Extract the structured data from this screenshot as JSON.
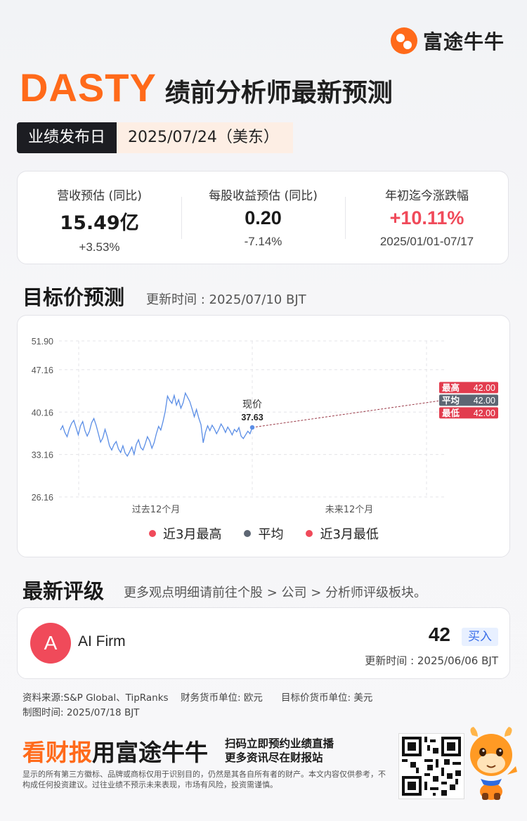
{
  "brand": {
    "logo_text": "富途牛牛"
  },
  "header": {
    "ticker": "DASTY",
    "title": "绩前分析师最新预测",
    "date_label": "业绩发布日",
    "date_value": "2025/07/24（美东）"
  },
  "stats": [
    {
      "label": "营收预估 (同比)",
      "value": "15.49亿",
      "sub": "+3.53%"
    },
    {
      "label": "每股收益预估 (同比)",
      "value": "0.20",
      "sub": "-7.14%"
    },
    {
      "label": "年初迄今涨跌幅",
      "value": "+10.11%",
      "sub": "2025/01/01-07/17"
    }
  ],
  "target_section": {
    "title": "目标价预测",
    "updated": "更新时间 : 2025/07/10 BJT"
  },
  "chart_data": {
    "type": "line",
    "y_ticks": [
      "51.90",
      "47.16",
      "40.16",
      "33.16",
      "26.16"
    ],
    "ylim": [
      26.16,
      51.9
    ],
    "x_labels": [
      "过去12个月",
      "未来12个月"
    ],
    "current_label": "现价",
    "current_price": "37.63",
    "history": [
      37.2,
      37.9,
      36.8,
      36.1,
      37.4,
      38.3,
      38.8,
      37.6,
      36.4,
      37.9,
      38.6,
      37.1,
      36.2,
      37.0,
      38.4,
      39.1,
      38.0,
      36.6,
      35.2,
      35.9,
      37.3,
      36.1,
      34.6,
      33.9,
      34.8,
      35.3,
      34.1,
      33.5,
      34.6,
      33.4,
      32.9,
      33.6,
      34.4,
      33.2,
      34.8,
      35.6,
      34.3,
      33.9,
      34.9,
      36.1,
      35.4,
      34.2,
      35.1,
      36.6,
      37.8,
      37.2,
      38.6,
      40.3,
      42.8,
      42.1,
      41.6,
      42.9,
      41.3,
      42.2,
      40.8,
      41.7,
      43.3,
      42.6,
      41.9,
      40.7,
      39.4,
      40.6,
      39.2,
      38.1,
      35.1,
      36.8,
      37.9,
      37.1,
      38.0,
      37.4,
      36.6,
      37.3,
      38.2,
      37.6,
      36.8,
      37.7,
      37.1,
      36.4,
      37.3,
      36.9,
      37.6,
      36.2,
      35.8,
      36.4,
      37.0,
      36.6,
      37.63
    ],
    "targets": [
      {
        "label": "最高",
        "value": "42.00",
        "color": "#e23c4e"
      },
      {
        "label": "平均",
        "value": "42.00",
        "color": "#5d6673"
      },
      {
        "label": "最低",
        "value": "42.00",
        "color": "#e23c4e"
      }
    ],
    "target_value": 42.0,
    "series_color": "#5b8ee6",
    "legend": [
      {
        "label": "近3月最高",
        "color": "#f04a5a"
      },
      {
        "label": "平均",
        "color": "#5d6673"
      },
      {
        "label": "近3月最低",
        "color": "#f04a5a"
      }
    ]
  },
  "ratings_section": {
    "title": "最新评级",
    "hint": "更多观点明细请前往个股 > 公司 > 分析师评级板块。",
    "items": [
      {
        "avatar": "A",
        "firm": "AI Firm",
        "price": "42",
        "rating": "买入",
        "updated": "更新时间 : 2025/06/06 BJT"
      }
    ]
  },
  "footer": {
    "source": "资料来源:S&P Global、TipRanks",
    "fin_currency": "财务货币单位: 欧元",
    "target_currency": "目标价货币单位: 美元",
    "made_time": "制图时间: 2025/07/18 BJT",
    "promo_a": "看财报",
    "promo_b": "用富途牛牛",
    "promo_line1": "扫码立即预约业绩直播",
    "promo_line2": "更多资讯尽在财报站",
    "disclaimer": "显示的所有第三方徽标、品牌或商标仅用于识别目的，仍然是其各自所有者的财产。本文内容仅供参考，不构成任何投资建议。过往业绩不预示未来表现，市场有风险，投资需谨慎。"
  }
}
